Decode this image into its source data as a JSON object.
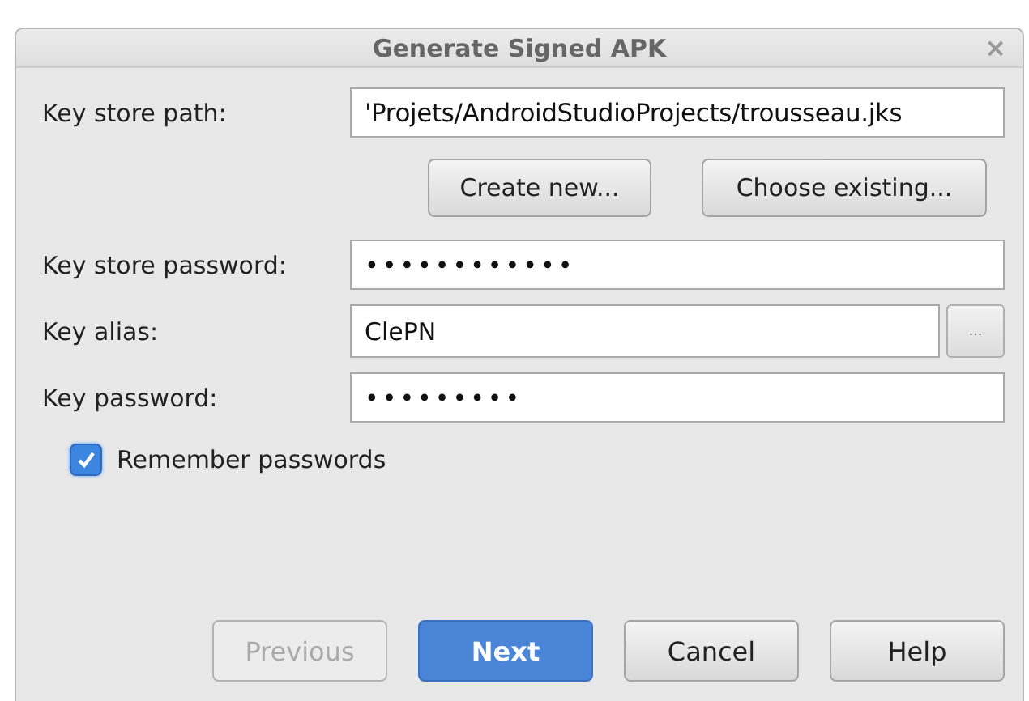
{
  "window": {
    "title": "Generate Signed APK",
    "close": "×"
  },
  "key_store_path": {
    "label": "Key store path:",
    "value": "'Projets/AndroidStudioProjects/trousseau.jks"
  },
  "path_buttons": [
    "Create new...",
    "Choose existing..."
  ],
  "fields": [
    {
      "kind": "password",
      "label": "Key store password:",
      "value": "••••••••••••"
    },
    {
      "kind": "browse",
      "label": "Key alias:",
      "value": "ClePN",
      "button": "..."
    },
    {
      "kind": "password",
      "label": "Key password:",
      "value": "•••••••••"
    }
  ],
  "remember": {
    "label": "Remember passwords",
    "checked": true
  },
  "buttons": [
    {
      "label": "Previous",
      "disabled": true,
      "primary": false
    },
    {
      "label": "Next",
      "disabled": false,
      "primary": true
    },
    {
      "label": "Cancel",
      "disabled": false,
      "primary": false
    },
    {
      "label": "Help",
      "disabled": false,
      "primary": false
    }
  ]
}
